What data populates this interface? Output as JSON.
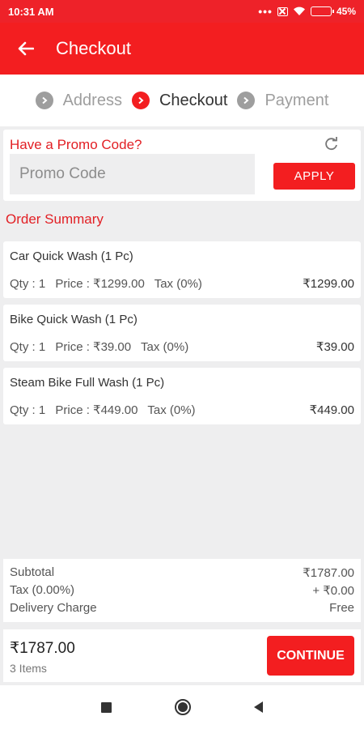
{
  "status_bar": {
    "time": "10:31 AM",
    "signal_dots": "•••",
    "battery": "45%",
    "battery_fraction": 0.45
  },
  "app_bar": {
    "title": "Checkout"
  },
  "stepper": {
    "steps": [
      {
        "label": "Address",
        "state": "done"
      },
      {
        "label": "Checkout",
        "state": "active"
      },
      {
        "label": "Payment",
        "state": "pending"
      }
    ]
  },
  "promo": {
    "title": "Have a Promo Code?",
    "placeholder": "Promo Code",
    "value": "",
    "apply_label": "APPLY"
  },
  "summary": {
    "label": "Order Summary"
  },
  "items": [
    {
      "name": "Car Quick Wash (1 Pc)",
      "qty": "Qty : 1",
      "price": "Price : ₹1299.00",
      "tax": "Tax (0%)",
      "total": "₹1299.00"
    },
    {
      "name": "Bike Quick Wash (1 Pc)",
      "qty": "Qty : 1",
      "price": "Price : ₹39.00",
      "tax": "Tax (0%)",
      "total": "₹39.00"
    },
    {
      "name": "Steam Bike Full  Wash (1 Pc)",
      "qty": "Qty : 1",
      "price": "Price : ₹449.00",
      "tax": "Tax (0%)",
      "total": "₹449.00"
    }
  ],
  "totals": [
    {
      "label": "Subtotal",
      "value": "₹1787.00"
    },
    {
      "label": "Tax (0.00%)",
      "value": "+ ₹0.00"
    },
    {
      "label": "Delivery Charge",
      "value": "Free"
    }
  ],
  "footer": {
    "grand_total": "₹1787.00",
    "item_count": "3 Items",
    "continue_label": "CONTINUE"
  },
  "colors": {
    "accent": "#f31e20",
    "accent_text": "#e21f24",
    "background": "#eeeeef"
  }
}
